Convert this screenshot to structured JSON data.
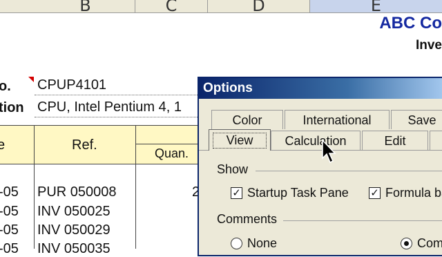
{
  "sheet": {
    "column_headers": [
      "B",
      "C",
      "D",
      "E"
    ],
    "company_title": "ABC Co",
    "report_title": "Inve",
    "fields": [
      {
        "label": "o.",
        "value": "CPUP4101"
      },
      {
        "label": "tion",
        "value": "CPU, Intel Pentium 4,  1"
      }
    ],
    "table_headers": {
      "col1": "e",
      "ref": "Ref.",
      "quantity": "Quan."
    },
    "rows": [
      {
        "date": "-05",
        "ref": "PUR 050008",
        "qty": "2"
      },
      {
        "date": "-05",
        "ref": "INV 050025",
        "qty": ""
      },
      {
        "date": "-05",
        "ref": "INV 050029",
        "qty": ""
      },
      {
        "date": "-05",
        "ref": "INV 050035",
        "qty": ""
      }
    ]
  },
  "dialog": {
    "title": "Options",
    "tabs_back": [
      "Color",
      "International",
      "Save"
    ],
    "tabs_front": [
      "View",
      "Calculation",
      "Edit"
    ],
    "active_tab": "View",
    "show_group": {
      "label": "Show",
      "startup_task_pane": {
        "label": "Startup Task Pane",
        "checked": true
      },
      "formula_bar": {
        "label": "Formula ba",
        "checked": true
      }
    },
    "comments_group": {
      "label": "Comments",
      "none": {
        "label": "None",
        "selected": false
      },
      "comment": {
        "label": "Com",
        "selected": true
      }
    }
  },
  "colors": {
    "company": "#1428a0",
    "header_row": "#fff8c4",
    "titlebar_start": "#0a246a",
    "dialog_bg": "#ece9d8"
  },
  "icons": {
    "cursor": "arrow-cursor-icon",
    "comment_marker": "comment-indicator-icon"
  }
}
